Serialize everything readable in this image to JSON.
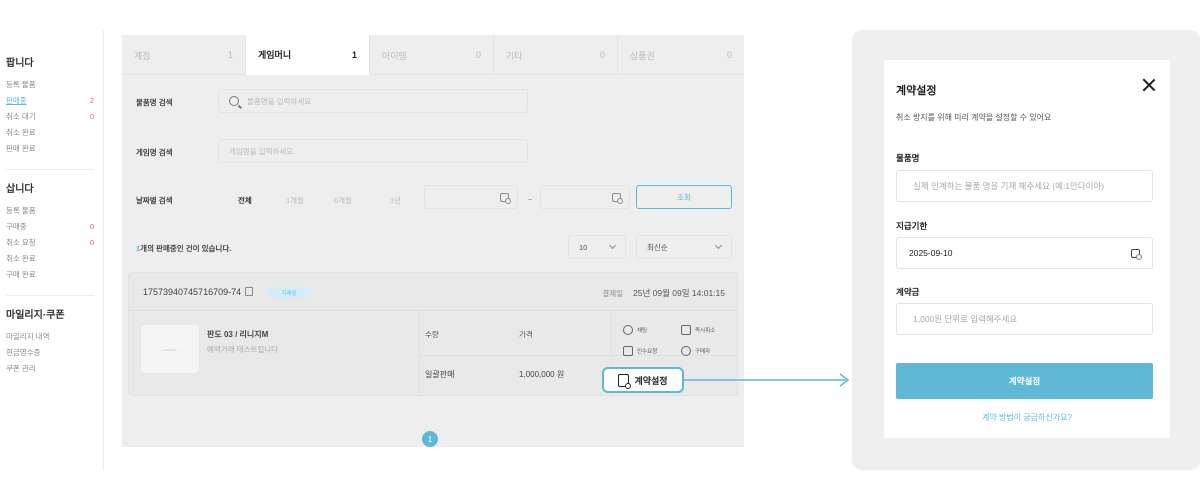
{
  "sidebar": {
    "sections": [
      {
        "title": "팝니다",
        "items": [
          {
            "label": "등록 물품",
            "count": ""
          },
          {
            "label": "판매중",
            "count": "2",
            "active": true
          },
          {
            "label": "취소 대기",
            "count": "0"
          },
          {
            "label": "취소 완료",
            "count": ""
          },
          {
            "label": "판매 완료",
            "count": ""
          }
        ]
      },
      {
        "title": "삽니다",
        "items": [
          {
            "label": "등록 물품",
            "count": ""
          },
          {
            "label": "구매중",
            "count": "0"
          },
          {
            "label": "취소 요청",
            "count": "0"
          },
          {
            "label": "취소 완료",
            "count": ""
          },
          {
            "label": "구매 완료",
            "count": ""
          }
        ]
      },
      {
        "title": "마일리지·쿠폰",
        "items": [
          {
            "label": "마일리지 내역",
            "count": ""
          },
          {
            "label": "현금영수증",
            "count": ""
          },
          {
            "label": "쿠폰 관리",
            "count": ""
          }
        ]
      }
    ]
  },
  "tabs": [
    {
      "label": "계정",
      "count": "1"
    },
    {
      "label": "게임머니",
      "count": "1",
      "active": true
    },
    {
      "label": "아이템",
      "count": "0"
    },
    {
      "label": "기타",
      "count": "0"
    },
    {
      "label": "상품권",
      "count": "0"
    }
  ],
  "filters": {
    "item_search_label": "물품명 검색",
    "item_search_placeholder": "물품명을 입력하세요",
    "game_search_label": "게임명 검색",
    "game_search_placeholder": "게임명을 입력하세요.",
    "date_search_label": "날짜별 검색",
    "periods": [
      "전체",
      "1개월",
      "6개월",
      "1년"
    ],
    "date_separator": "~",
    "query_button": "조회"
  },
  "list_header": {
    "count_prefix": "1",
    "count_text": "개의 판매중인 건이 있습니다.",
    "page_size": "10",
    "sort": "최신순"
  },
  "order": {
    "order_no": "1757394074571670​9-74",
    "badge": "거래중",
    "pay_date_label": "결제일",
    "pay_date": "25년 09월 09일 14:01:15",
    "thumb_text": "— sample —",
    "product_name": "판도 03 / 리니지M",
    "product_desc": "예약거래 테스트입니다",
    "qty_label": "수량",
    "qty_value": "일괄판매",
    "price_label": "가격",
    "price_value": "1,000,000 원",
    "actions": [
      "채팅",
      "즉시취소",
      "인수요청",
      "구매자"
    ],
    "contract_button": "계약설정"
  },
  "pagination": {
    "current": "1"
  },
  "modal": {
    "title": "계약설정",
    "subtitle": "취소 방지를 위해 미리 계약을 설정할 수 있어요",
    "item_label": "물품명",
    "item_placeholder": "실제 인계하는 물품 명을 기재 해주세요 (예:1만다이아)",
    "deadline_label": "지급기한",
    "deadline_value": "2025-09-10",
    "deposit_label": "계약금",
    "deposit_placeholder": "1,000원 단위로 입력해주세요",
    "submit": "계약설정",
    "help": "계약 방법이 궁금하신가요?"
  },
  "colors": {
    "accent": "#5fb9d6",
    "alert": "#f05a5a"
  }
}
